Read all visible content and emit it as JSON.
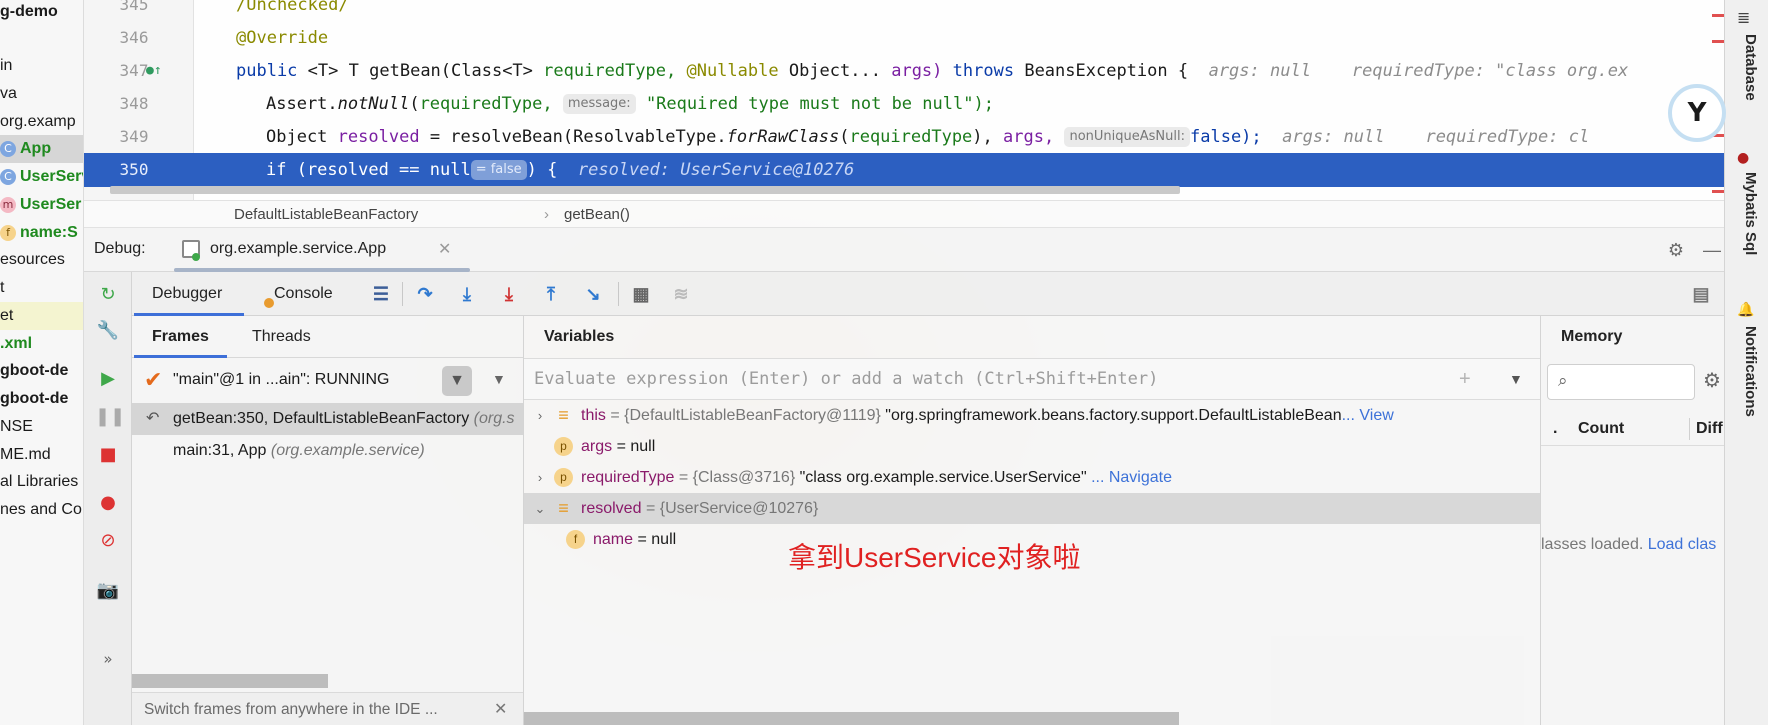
{
  "project_tree": {
    "items": [
      "g-demo",
      "in",
      "va",
      "org.examp",
      "App",
      "UserServ",
      "UserSer",
      "name:S",
      "esources",
      "t",
      "et",
      ".xml",
      "gboot-de",
      "gboot-de",
      "NSE",
      "ME.md",
      "al Libraries",
      "nes and Co"
    ]
  },
  "editor": {
    "lines": [
      {
        "num": "345",
        "text": "/Unchecked/"
      },
      {
        "num": "346",
        "text": "@Override"
      },
      {
        "num": "347",
        "tokens": [
          "public",
          "<T>",
          "T",
          "getBean(Class<T>",
          "requiredType,",
          "@Nullable",
          "Object...",
          "args)",
          "throws",
          "BeansException {"
        ],
        "inlay": [
          "args: null",
          "requiredType: \"class org.ex"
        ]
      },
      {
        "num": "348",
        "pre": "Assert.",
        "method": "notNull",
        "arg": "requiredType,",
        "hint": "message:",
        "post": "\"Required type must not be null\");"
      },
      {
        "num": "349",
        "pre": "Object",
        "var": "resolved",
        "mid": "= resolveBean(ResolvableType.",
        "method": "forRawClass",
        "arg": "requiredType",
        "mid2": "),",
        "arg2": "args,",
        "hint": "nonUniqueAsNull:",
        "post": "false);",
        "inlay": [
          "args: null",
          "requiredType: cl"
        ]
      },
      {
        "num": "350",
        "pre": "if (resolved == null",
        "hint": "= false",
        "post": ") {",
        "inlay": "resolved: UserService@10276"
      }
    ],
    "breadcrumbs": [
      "DefaultListableBeanFactory",
      "getBean()"
    ]
  },
  "debug": {
    "label": "Debug:",
    "run_config": "org.example.service.App",
    "tabs": {
      "debugger": "Debugger",
      "console": "Console"
    }
  },
  "frames": {
    "tabs": [
      "Frames",
      "Threads"
    ],
    "thread": "\"main\"@1 in ...ain\": RUNNING",
    "rows": [
      {
        "method": "getBean:350, DefaultListableBeanFactory",
        "pkg": "(org.s"
      },
      {
        "method": "main:31, App",
        "pkg": "(org.example.service)"
      }
    ],
    "hint": "Switch frames from anywhere in the IDE ..."
  },
  "variables": {
    "title": "Variables",
    "placeholder": "Evaluate expression (Enter) or add a watch (Ctrl+Shift+Enter)",
    "rows": [
      {
        "name": "this",
        "id": "= {DefaultListableBeanFactory@1119}",
        "value": " \"org.springframework.beans.factory.support.DefaultListableBean",
        "link": "... View",
        "badge": "field-stack",
        "expand": "›"
      },
      {
        "name": "args",
        "id": "",
        "value": " = null",
        "link": "",
        "badge": "p",
        "expand": ""
      },
      {
        "name": "requiredType",
        "id": "= {Class@3716}",
        "value": " \"class org.example.service.UserService\"",
        "link": " ... Navigate",
        "badge": "p",
        "expand": "›"
      },
      {
        "name": "resolved",
        "id": "= {UserService@10276}",
        "value": "",
        "link": "",
        "badge": "field-stack",
        "expand": "⌄"
      },
      {
        "name": "name",
        "id": "",
        "value": " = null",
        "link": "",
        "badge": "f",
        "expand": ""
      }
    ],
    "annotation": "拿到UserService对象啦"
  },
  "memory": {
    "title": "Memory",
    "col_count": "Count",
    "col_diff": "Diff",
    "dot": ".",
    "status_prefix": "lasses loaded. ",
    "status_link": "Load clas"
  },
  "right_strip": {
    "labels": [
      "Database",
      "Mybatis Sql",
      "Notifications"
    ]
  },
  "colors": {
    "selection": "#2c5fc1",
    "accent": "#3d6fd8",
    "annotation": "#e02121"
  }
}
